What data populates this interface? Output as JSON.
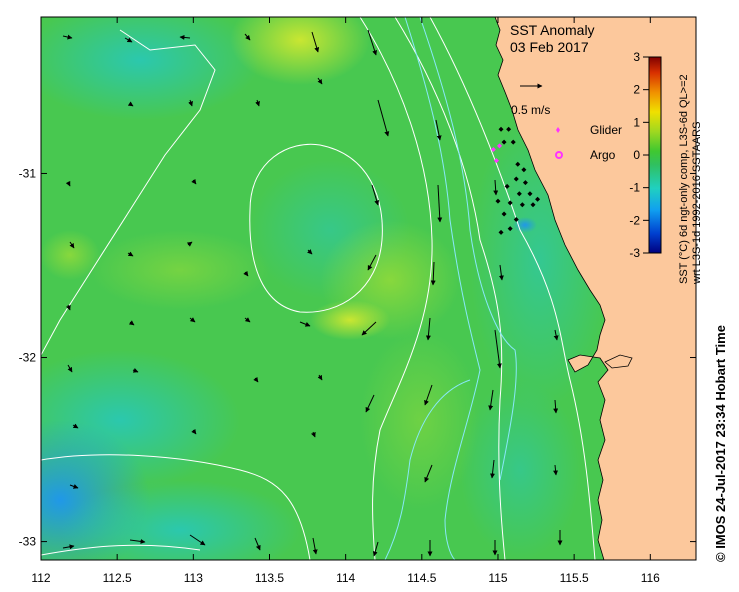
{
  "title": "SST Anomaly",
  "date": "03 Feb 2017",
  "scale_vector_label": "0.5 m/s",
  "legend": {
    "glider": {
      "label": "Glider",
      "color": "#ff33ff"
    },
    "argo": {
      "label": "Argo",
      "color": "#ff33ff"
    }
  },
  "colorbar": {
    "label_line1": "SST (°C) 6d ngt-only comp, L3S-6d QL>=2",
    "label_line2": "wrt L3S-1d 1992-2016 SSTAARS",
    "ticks": [
      "3",
      "2",
      "1",
      "0",
      "-1",
      "-2",
      "-3"
    ],
    "range": [
      -3,
      3
    ],
    "colors": [
      "#000080",
      "#0050d8",
      "#20b8f0",
      "#30d890",
      "#30c030",
      "#a0d820",
      "#f0e000",
      "#f09000",
      "#d83000",
      "#800000"
    ]
  },
  "x_ticks": [
    "112",
    "112.5",
    "113",
    "113.5",
    "114",
    "114.5",
    "115",
    "115.5",
    "116"
  ],
  "y_ticks": [
    "-31",
    "-32",
    "-33"
  ],
  "footer": "© IMOS 24-Jul-2017 23:34 Hobart Time",
  "colors": {
    "land": "#fcc89c",
    "ocean_base": "#3cc85a",
    "contour": "#ffffff",
    "contour_light": "#88e8f8"
  },
  "chart_data": {
    "type": "map",
    "x_range": [
      112,
      116.3
    ],
    "y_range": [
      -33.1,
      -30.15
    ],
    "glider_positions": [
      [
        114.97,
        -30.87
      ],
      [
        114.99,
        -30.93
      ],
      [
        115.01,
        -30.85
      ]
    ],
    "argo_positions": [],
    "mooring_stations": [
      [
        115.02,
        -30.76
      ],
      [
        115.07,
        -30.76
      ],
      [
        115.04,
        -30.83
      ],
      [
        115.1,
        -30.83
      ],
      [
        115.13,
        -30.95
      ],
      [
        115.17,
        -30.98
      ],
      [
        115.12,
        -31.03
      ],
      [
        115.18,
        -31.05
      ],
      [
        115.06,
        -31.07
      ],
      [
        115.14,
        -31.11
      ],
      [
        115.21,
        -31.11
      ],
      [
        115.26,
        -31.14
      ],
      [
        115.0,
        -31.15
      ],
      [
        115.08,
        -31.16
      ],
      [
        115.16,
        -31.17
      ],
      [
        115.23,
        -31.17
      ],
      [
        115.04,
        -31.22
      ],
      [
        115.12,
        -31.25
      ],
      [
        115.02,
        -31.32
      ],
      [
        115.08,
        -31.3
      ]
    ]
  }
}
